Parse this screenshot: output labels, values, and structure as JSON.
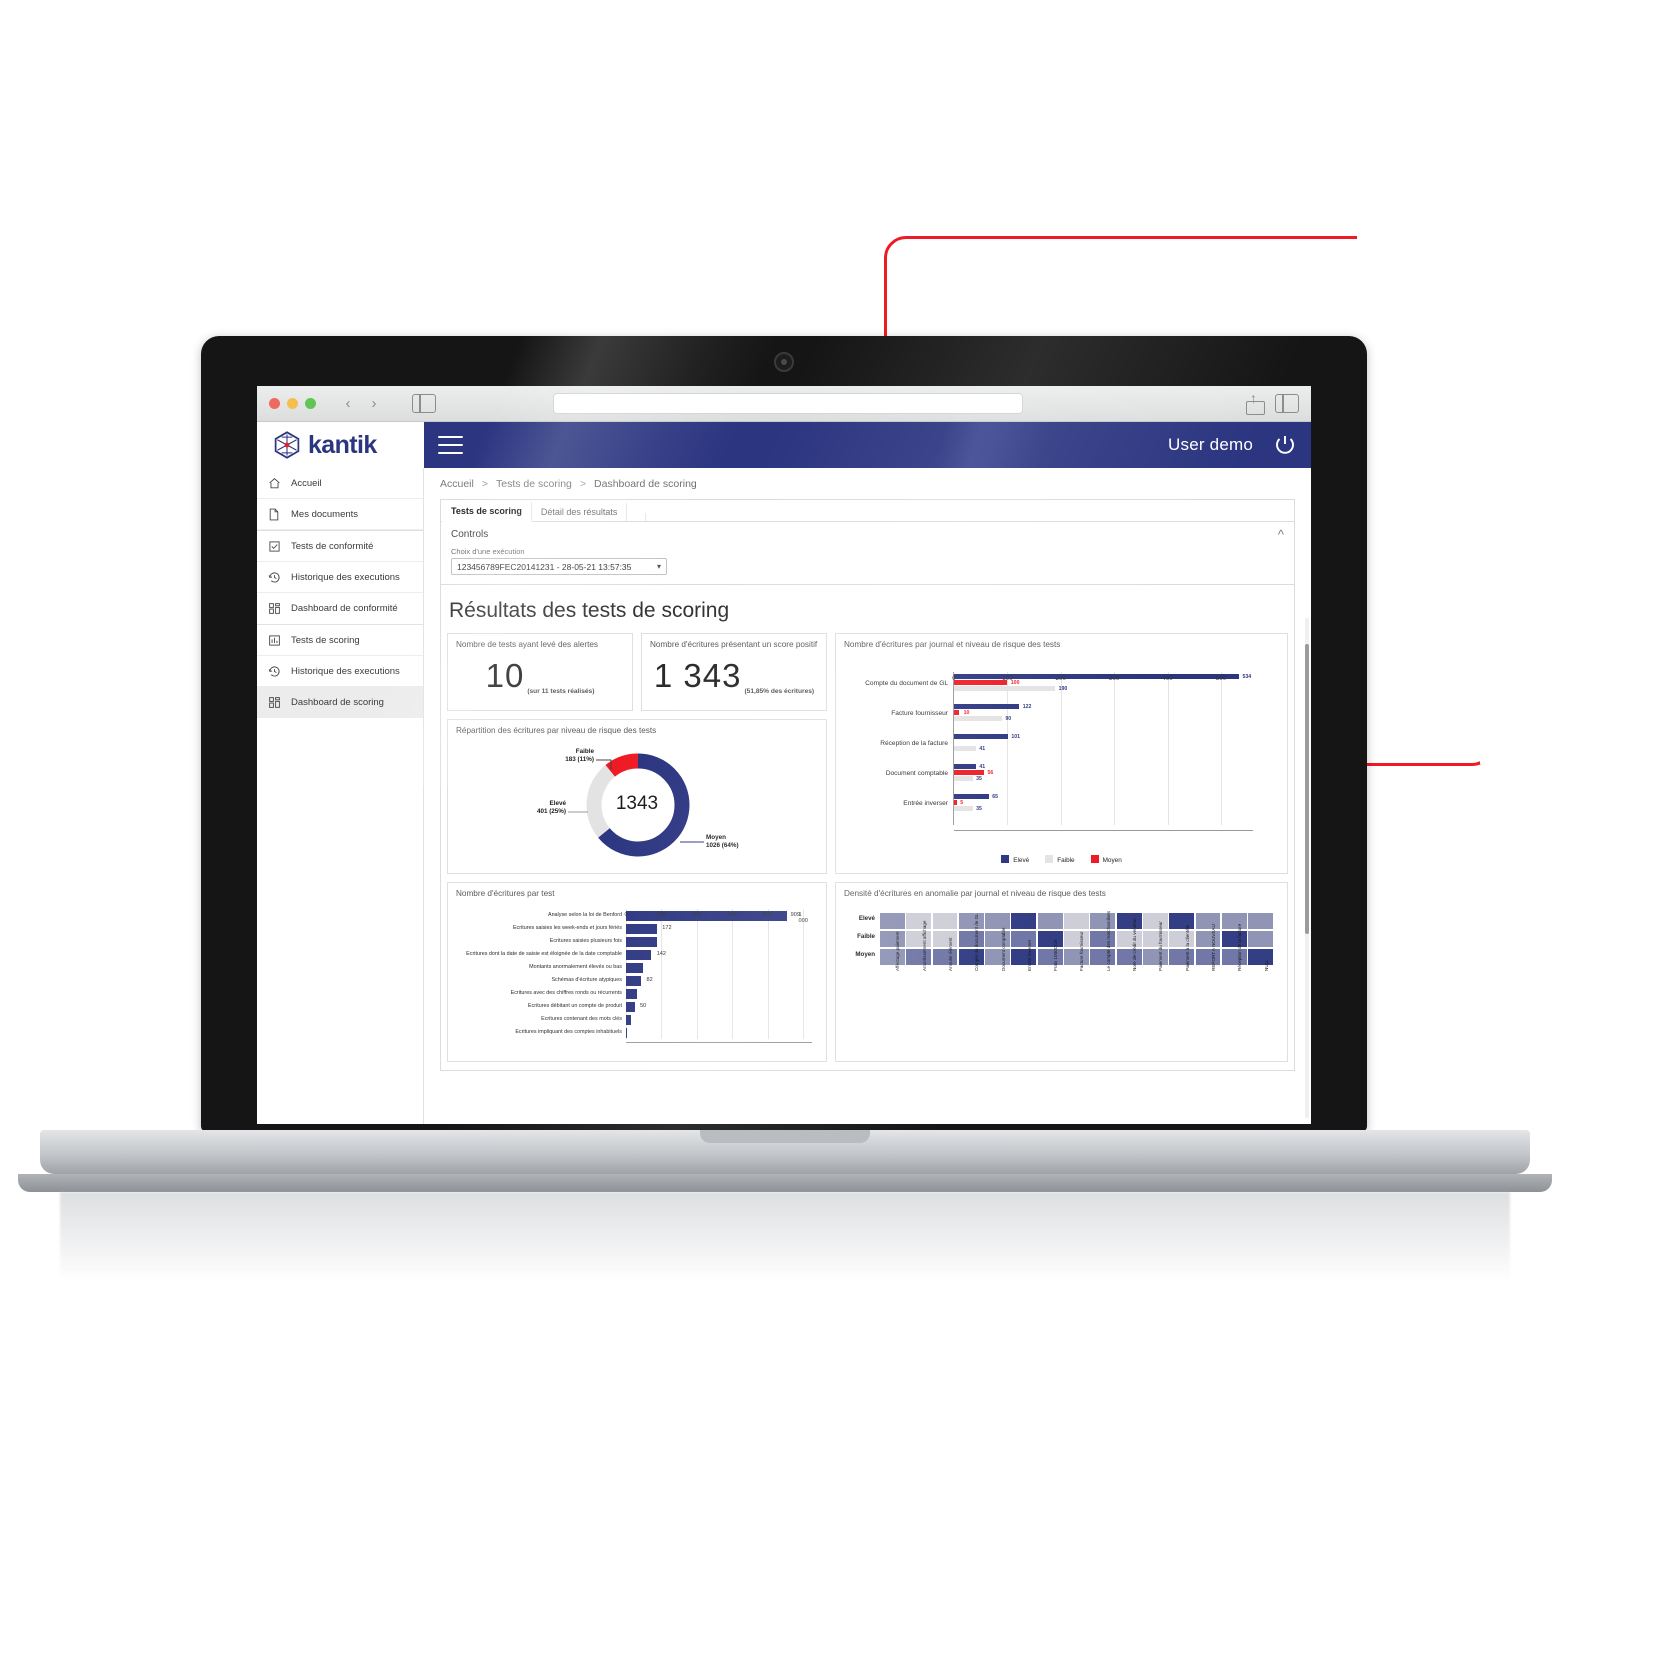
{
  "browser": {
    "back_icon": "chevron-left-icon",
    "forward_icon": "chevron-right-icon",
    "sidebar_icon": "sidebar-toggle-icon",
    "url_value": "",
    "url_placeholder": "",
    "share_icon": "share-icon",
    "tabs_icon": "show-tabs-icon"
  },
  "brand": {
    "name": "kantik"
  },
  "topbar": {
    "menu_icon": "hamburger-menu-icon",
    "user": "User demo",
    "power_icon": "power-icon"
  },
  "sidebar": {
    "items": [
      {
        "label": "Accueil",
        "icon": "home-icon",
        "active": false
      },
      {
        "label": "Mes documents",
        "icon": "document-icon",
        "active": false
      },
      {
        "label": "Tests de conformité",
        "icon": "checklist-icon",
        "active": false
      },
      {
        "label": "Historique des executions",
        "icon": "history-icon",
        "active": false
      },
      {
        "label": "Dashboard de conformité",
        "icon": "dashboard-icon",
        "active": false
      },
      {
        "label": "Tests de scoring",
        "icon": "bar-chart-icon",
        "active": false
      },
      {
        "label": "Historique des executions",
        "icon": "history-icon",
        "active": false
      },
      {
        "label": "Dashboard de scoring",
        "icon": "dashboard-icon",
        "active": true
      }
    ]
  },
  "breadcrumb": {
    "items": [
      "Accueil",
      "Tests de scoring",
      "Dashboard de scoring"
    ],
    "separator": ">"
  },
  "tabs": [
    {
      "label": "Tests de scoring",
      "active": true
    },
    {
      "label": "Détail des résultats",
      "active": false
    }
  ],
  "controls": {
    "title": "Controls",
    "collapse_icon": "chevron-up-icon",
    "select_label": "Choix d'une exécution",
    "select_value": "123456789FEC20141231 - 28-05-21 13:57:35",
    "select_caret": "chevron-down-icon"
  },
  "page_title": "Résultats des tests de scoring",
  "kpis": [
    {
      "title": "Nombre de tests ayant levé des alertes",
      "value": "10",
      "sub": "(sur 11 tests réalisés)"
    },
    {
      "title": "Nombre d'écritures présentant un score positif",
      "value": "1 343",
      "sub": "(51,85% des écritures)"
    }
  ],
  "colors": {
    "brand_blue": "#2b3580",
    "red": "#ee1b24",
    "grey": "#e3e3e3"
  },
  "chart_data": [
    {
      "type": "pie",
      "name": "donut-repartition",
      "title": "Répartition des écritures par niveau de risque des tests",
      "center_value": "1343",
      "slices": [
        {
          "label": "Faible",
          "value": 183,
          "percent": "11%",
          "caption": "183 (11%)",
          "color": "#ee1b24"
        },
        {
          "label": "Elevé",
          "value": 401,
          "percent": "25%",
          "caption": "401 (25%)",
          "color": "#e3e3e3"
        },
        {
          "label": "Moyen",
          "value": 1026,
          "percent": "64%",
          "caption": "1026 (64%)",
          "color": "#2b3580"
        }
      ],
      "legend": "annotations"
    },
    {
      "type": "bar",
      "orientation": "horizontal",
      "name": "journal-risk-bars",
      "title": "Nombre d'écritures par journal et niveau de risque des tests",
      "categories": [
        "Compte du document de GL",
        "Facture fournisseur",
        "Réception de la facture",
        "Document comptable",
        "Entrée inverser"
      ],
      "series": [
        {
          "name": "Elevé",
          "color": "#2b3580",
          "values": [
            534,
            122,
            101,
            41,
            65
          ]
        },
        {
          "name": "Moyen",
          "color": "#ee1b24",
          "values": [
            100,
            10,
            0,
            56,
            5
          ]
        },
        {
          "name": "Faible",
          "color": "#e3e3e3",
          "values": [
            190,
            90,
            41,
            35,
            35
          ]
        }
      ],
      "legend": [
        "Elevé",
        "Faible",
        "Moyen"
      ],
      "xticks": [
        0,
        100,
        200,
        300,
        400,
        500
      ],
      "xlim": [
        0,
        560
      ],
      "grid": true
    },
    {
      "type": "bar",
      "orientation": "horizontal",
      "name": "ecritures-par-test",
      "title": "Nombre d'écritures par test",
      "categories": [
        "Analyse selon la loi de Benford",
        "Ecritures saisies les week-ends et jours fériés",
        "Ecritures saisies plusieurs fois",
        "Ecritures dont la date de saisie est éloignée de la date comptable",
        "Montants anormalement élevés ou bas",
        "Schémas d'écriture atypiques",
        "Ecritures avec des chiffres ronds ou récurrents",
        "Ecritures débitant un compte de produit",
        "Ecritures contenant des mots clés",
        "Ecritures impliquant des comptes inhabituels"
      ],
      "values": [
        909,
        172,
        172,
        142,
        95,
        82,
        62,
        50,
        30,
        8
      ],
      "labels": [
        "909",
        "172",
        "",
        "142",
        "",
        "82",
        "",
        "50",
        "",
        ""
      ],
      "xticks": [
        0,
        200,
        400,
        600,
        800,
        1000
      ],
      "xtick_labels": [
        "0",
        "200",
        "400",
        "600",
        "800",
        "1 000"
      ],
      "xlim": [
        0,
        1050
      ],
      "color": "#2b3580",
      "grid": true
    },
    {
      "type": "heatmap",
      "name": "densite-anomalie",
      "title": "Densité d'écritures en anomalie par journal et niveau de risque des tests",
      "rows": [
        "Elevé",
        "Faible",
        "Moyen"
      ],
      "columns": [
        "Affectage paiement",
        "Amortissement affichage",
        "Annuler élément",
        "Compte du document de GL",
        "Document comptable",
        "Entrée inverser",
        "Frais 1000CCE",
        "Facture fournisseur",
        "Le compte des marchandises",
        "Note de crédit du vendeur",
        "Paiement du fournisseur",
        "Paiement à la clientèle",
        "REPORT A NOUVEAU",
        "Réception de la facture",
        "NULL"
      ],
      "values": [
        [
          0.45,
          0.12,
          0.12,
          0.45,
          0.45,
          0.95,
          0.45,
          0.12,
          0.45,
          0.95,
          0.12,
          0.95,
          0.45,
          0.45,
          0.45
        ],
        [
          0.45,
          0.12,
          0.12,
          0.62,
          0.45,
          0.62,
          0.95,
          0.12,
          0.62,
          0.12,
          0.12,
          0.12,
          0.45,
          0.95,
          0.45
        ],
        [
          0.45,
          0.62,
          0.62,
          0.95,
          0.45,
          0.95,
          0.62,
          0.45,
          0.62,
          0.62,
          0.45,
          0.62,
          0.62,
          0.62,
          0.95
        ]
      ],
      "scale_low": "#e3e3e3",
      "scale_high": "#2b3580"
    }
  ]
}
